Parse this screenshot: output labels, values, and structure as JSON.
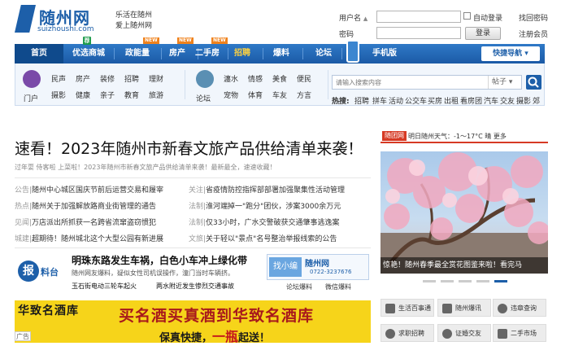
{
  "header": {
    "logo_text": "随州网",
    "logo_domain": "suizhoushi.com",
    "slogan_line1": "乐活在随州",
    "slogan_line2": "爱上随州网",
    "username_label": "用户名",
    "password_label": "密码",
    "auto_login": "自动登录",
    "login_button": "登录",
    "find_password": "找回密码",
    "register": "注册会员"
  },
  "nav": {
    "items": [
      "首页",
      "优选商城",
      "政能量",
      "房产",
      "二手房",
      "招聘",
      "爆料",
      "论坛",
      "手机版"
    ],
    "tag_recommend": "荐",
    "tag_new": "NEW",
    "quick_nav": "快捷导航"
  },
  "subnav": {
    "portal_label": "门户",
    "portal_row1": [
      "民声",
      "房产",
      "装修",
      "招聘",
      "理财"
    ],
    "portal_row2": [
      "摄影",
      "健康",
      "亲子",
      "教育",
      "旅游"
    ],
    "forum_label": "论坛",
    "forum_row1": [
      "瀍水",
      "情感",
      "美食",
      "便民"
    ],
    "forum_row2": [
      "宠物",
      "体育",
      "车友",
      "方言"
    ],
    "search_placeholder": "请输入搜索内容",
    "search_scope": "帖子",
    "hot_label": "热搜:",
    "hot_links": [
      "招聘",
      "拼车",
      "活动",
      "公交车",
      "买房",
      "出租",
      "看房团",
      "汽车",
      "交友",
      "摄影",
      "郊"
    ]
  },
  "main": {
    "headline": "速看！2023年随州市新春文旅产品供给清单来袭！",
    "subline": "过年耍  侍客啦  上菜啦！2023年随州市新春文旅产品供给清单来袭！最新最全，速速收藏！",
    "news_left": [
      {
        "cat": "公告|",
        "text": "随州中心城区国庆节前后运营交易和履宰"
      },
      {
        "cat": "热点|",
        "text": "随州关于加强解放路商业街管理的通告"
      },
      {
        "cat": "见闻|",
        "text": "万店派出所抓获一名跨省流窜盗窃惯犯"
      },
      {
        "cat": "城建|",
        "text": "超期待！随州城北这个大型公园有新进展"
      }
    ],
    "news_right": [
      {
        "cat": "关注|",
        "text": "省疫情防控指挥部部署加强聚集性活动管理"
      },
      {
        "cat": "法制|",
        "text": "淮河端掉一\"跑分\"团伙，涉案3000余万元"
      },
      {
        "cat": "法制|",
        "text": "仅33小时，广水交警破获交通肇事逃逸案"
      },
      {
        "cat": "文旅|",
        "text": "关于轻以\"景点\"名号整治举报线索的公告"
      }
    ],
    "baoliao": {
      "badge": "报",
      "label": "料台",
      "title": "明珠东路发生车祸，白色小车冲上绿化带",
      "desc": "随州网友爆料，疑似女性司机误操作，潼门当时车辆挤。",
      "sub1": "玉石街电动三轮车起火",
      "sub2": "两水附近发生惨烈交通事故"
    },
    "qr": {
      "find": "找小编",
      "brand": "随州网",
      "phone": "0722-3237676",
      "cap1": "论坛爆料",
      "cap2": "微信爆料"
    },
    "banner": {
      "logo": "华致名酒库",
      "main": "买名酒买真酒到华致名酒库",
      "sub_pre": "保真快捷，",
      "sub_red": "一瓶",
      "sub_post": "起送！",
      "ad": "广告"
    }
  },
  "right": {
    "tag": "随团网",
    "weather": "明日随州天气：-1～17°C 晴 更多",
    "photo_caption": "惊艳！随州春季最全赏花图鉴来啦！看完马",
    "services": [
      "生活百事通",
      "随州爆讯",
      "违章查询",
      "求职招聘",
      "证婚交友",
      "二手市场"
    ]
  }
}
